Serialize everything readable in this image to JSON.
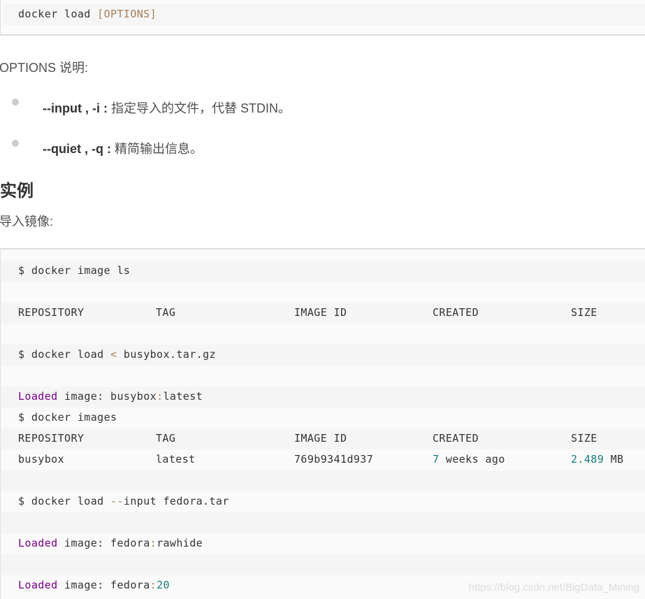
{
  "syntax": {
    "cmd": "docker load ",
    "options": "[OPTIONS]"
  },
  "options_heading": "OPTIONS 说明:",
  "options_list": [
    {
      "flag": "--input , -i :",
      "desc": " 指定导入的文件，代替 STDIN。"
    },
    {
      "flag": "--quiet , -q :",
      "desc": " 精简输出信息。"
    }
  ],
  "section_title": "实例",
  "intro": "导入镜像:",
  "code": {
    "cmd_ls": "$ docker image ls",
    "headers": [
      "REPOSITORY",
      "TAG",
      "IMAGE ID",
      "CREATED",
      "SIZE"
    ],
    "cmd_load_busybox": {
      "pre": "$ docker load ",
      "op": "<",
      "post": " busybox.tar.gz"
    },
    "loaded1": {
      "kw": "Loaded",
      "mid": " image: busybox",
      "op": ":",
      "post": "latest"
    },
    "cmd_images": "$ docker images",
    "busybox_row": {
      "repo": "busybox",
      "tag": "latest",
      "image_id": "769b9341d937",
      "created_num": "7",
      "created_rest": " weeks ago",
      "size_num": "2.489",
      "size_unit": " MB"
    },
    "cmd_load_fedora": {
      "pre": "$ docker load ",
      "op": "--",
      "post": "input fedora.tar"
    },
    "loaded2": {
      "kw": "Loaded",
      "mid": " image: fedora",
      "op": ":",
      "post": "rawhide"
    },
    "loaded3": {
      "kw": "Loaded",
      "mid": " image: fedora",
      "op": ":",
      "num": "20"
    }
  },
  "watermark": "https://blog.csdn.net/BigData_Mining"
}
